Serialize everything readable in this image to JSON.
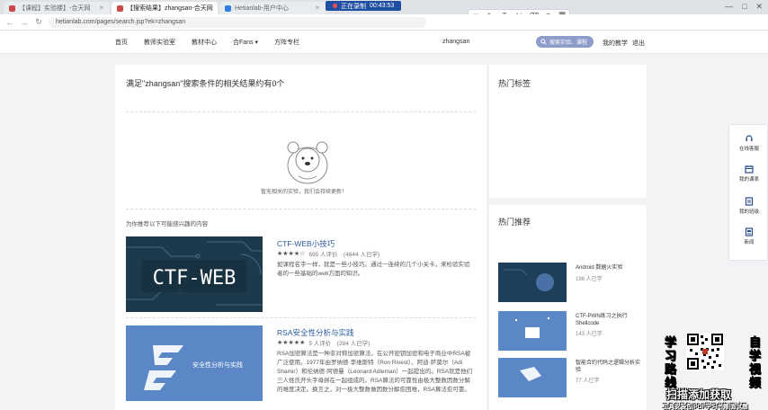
{
  "browser": {
    "tabs": [
      {
        "label": "【课程】实验楼】-合天网",
        "active": false
      },
      {
        "label": "【搜索结果】zhangsan-合天网",
        "active": true
      },
      {
        "label": "Hetianlab-用户中心",
        "active": false
      }
    ],
    "new_tab": "+",
    "recording": {
      "label": "正在录制",
      "time": "00:43:53"
    },
    "url": "hetianlab.com/pages/search.jsp?ek=zhangsan",
    "window_controls": [
      "—",
      "□",
      "✕"
    ],
    "annotation_tools": [
      "□",
      "✎",
      "T",
      "⇲",
      "⌫",
      "↶",
      "🗑"
    ]
  },
  "header": {
    "nav": [
      "首页",
      "教师实验室",
      "教材中心",
      "合Fans ▾",
      "方阵专栏"
    ],
    "username": "zhangsan",
    "search_label": "搜索实验、课程",
    "my_class": "我的教学",
    "exit": "退出"
  },
  "main": {
    "result_title": "满足\"zhangsan\"搜索条件的相关结果约有0个",
    "empty_text": "暂无相关的实验，我们会持续更新！",
    "rec_label": "为你推荐以下可能感兴趣的内容",
    "courses": [
      {
        "title": "CTF-WEB小技巧",
        "thumb_text": "CTF-WEB",
        "stars": "★★★★☆",
        "meta": "695 人评价　(4644 人已学)",
        "desc": "如课程名字一样，就是一些小技巧。通过一连续的几个小关卡，来检验实验者的一些基础的web方面的知识。"
      },
      {
        "title": "RSA安全性分析与实践",
        "thumb_text": "安全性分析与实践",
        "stars": "★★★★★",
        "meta": "5 人评价　(284 人已学)",
        "desc": "RSA加密算法是一种非对称加密算法，在公开密钥加密和电子商业中RSA被广泛使用。1977年由罗纳德·李维斯特（Ron Rivest）、阿迪·萨莫尔（Adi Shamir）和伦纳德·阿德曼（Leonard Adleman）一起提出的。RSA就是他们三人姓氏开头字母拼在一起组成的。RSA算法的可靠性由极大整数因数分解的难度决定。换言之，对一极大整数做因数分解愈困难，RSA算法愈可靠。"
      }
    ]
  },
  "sidebar": {
    "hot_tags_title": "热门标签",
    "hot_rec_title": "热门推荐",
    "items": [
      {
        "title": "Android 数据火实验",
        "count": "196 人已学"
      },
      {
        "title": "CTF-PWN练习之执行Shellcode",
        "count": "143 人已学"
      },
      {
        "title": "智能合约代码之逻辑分析实验",
        "count": "77 人已学"
      }
    ]
  },
  "floatbar": [
    {
      "label": "在线客服",
      "icon": "headset-icon"
    },
    {
      "label": "我的课表",
      "icon": "calendar-icon"
    },
    {
      "label": "我的班级",
      "icon": "class-icon"
    },
    {
      "label": "新闻",
      "icon": "news-icon"
    }
  ],
  "promo": {
    "left_chars": [
      "学",
      "习",
      "路",
      "线"
    ],
    "right_chars": [
      "自",
      "学",
      "视",
      "频"
    ],
    "cta": "扫描添加获取",
    "sub": "工具安装包|PDF学习书籍|面试题"
  },
  "colors": {
    "accent": "#2a5a9e",
    "thumb_dark": "#1d3a4c",
    "thumb_blue": "#5b87c6",
    "search_pill": "#8e9cc9"
  }
}
